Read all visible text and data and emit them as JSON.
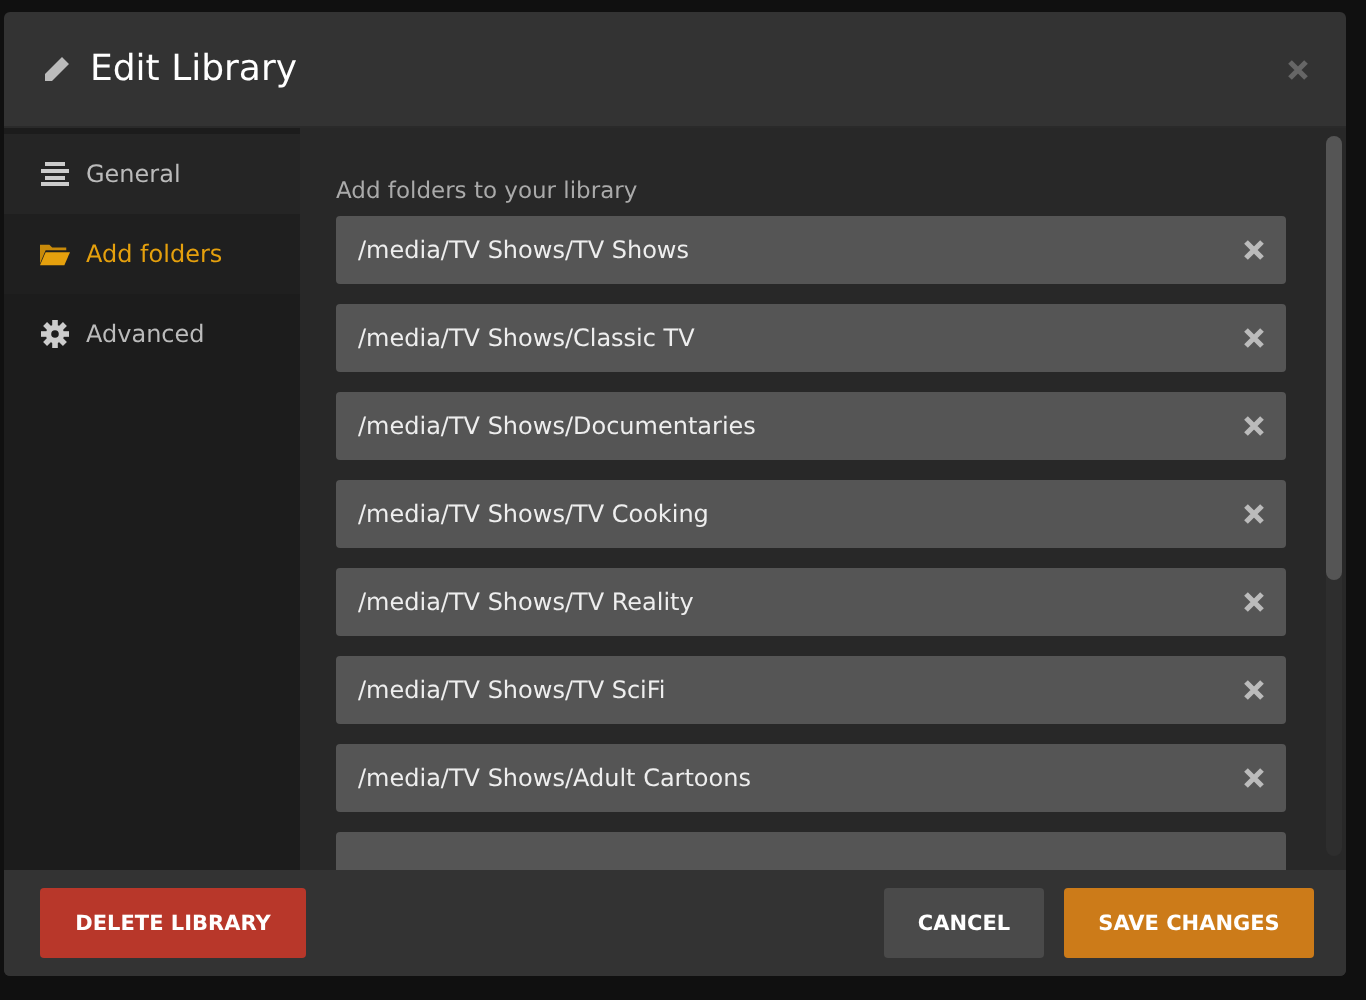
{
  "dialog": {
    "title": "Edit Library"
  },
  "sidebar": {
    "items": [
      {
        "label": "General",
        "kind": "lines",
        "selected": false
      },
      {
        "label": "Add folders",
        "kind": "folder",
        "selected": true
      },
      {
        "label": "Advanced",
        "kind": "gear",
        "selected": false
      }
    ]
  },
  "content": {
    "heading": "Add folders to your library",
    "folders": [
      {
        "kind": "folder",
        "path": "/media/TV Shows/TV Shows"
      },
      {
        "kind": "folder",
        "path": "/media/TV Shows/Classic TV"
      },
      {
        "kind": "folder",
        "path": "/media/TV Shows/Documentaries"
      },
      {
        "kind": "folder",
        "path": "/media/TV Shows/TV Cooking"
      },
      {
        "kind": "folder",
        "path": "/media/TV Shows/TV Reality"
      },
      {
        "kind": "folder",
        "path": "/media/TV Shows/TV SciFi"
      },
      {
        "kind": "folder",
        "path": "/media/TV Shows/Adult Cartoons"
      },
      {
        "kind": "partial"
      }
    ]
  },
  "footer": {
    "delete": "DELETE LIBRARY",
    "cancel": "CANCEL",
    "save": "SAVE CHANGES"
  }
}
